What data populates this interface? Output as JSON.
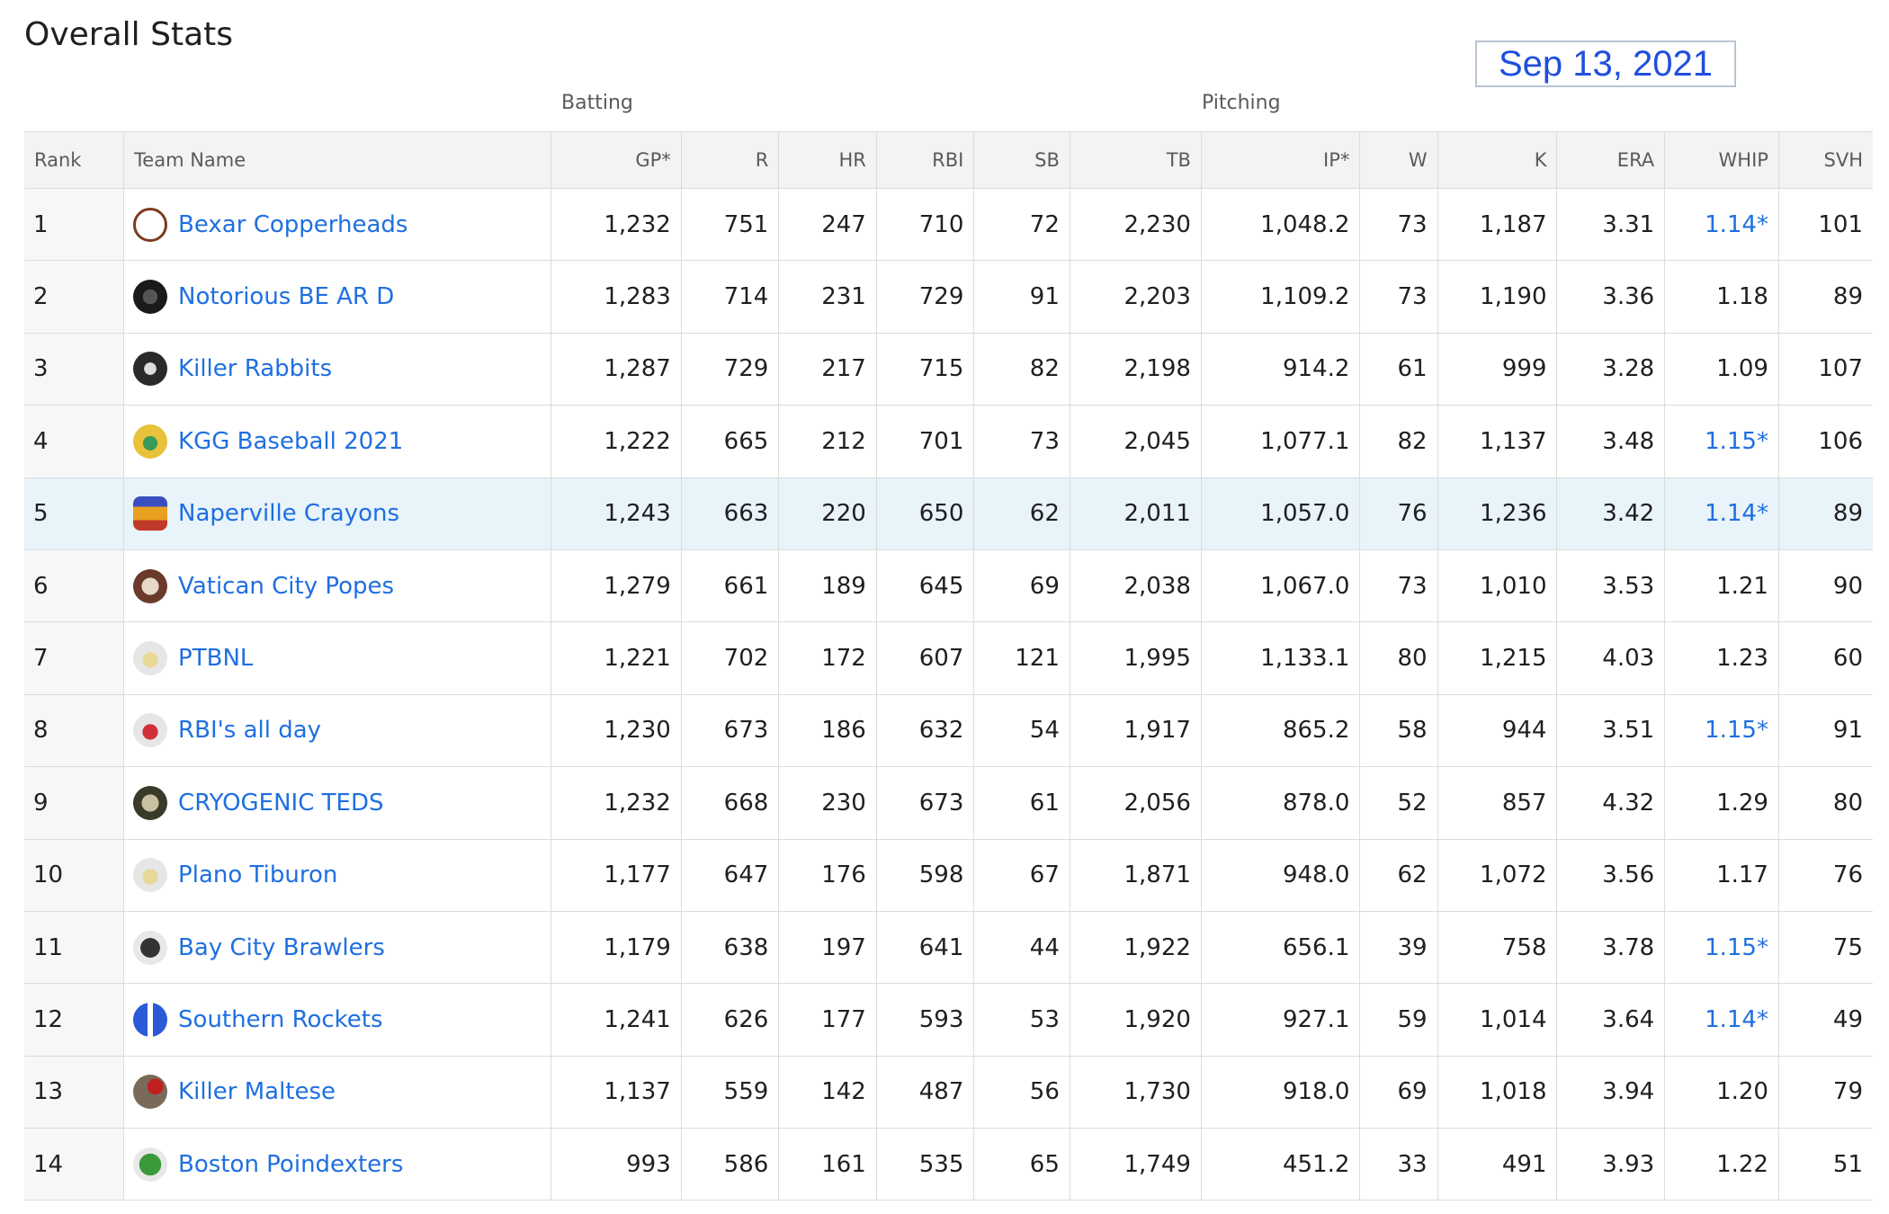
{
  "page": {
    "title": "Overall Stats",
    "date": "Sep 13, 2021",
    "group_batting": "Batting",
    "group_pitching": "Pitching"
  },
  "columns": [
    "Rank",
    "Team Name",
    "GP*",
    "R",
    "HR",
    "RBI",
    "SB",
    "TB",
    "IP*",
    "W",
    "K",
    "ERA",
    "WHIP",
    "SVH"
  ],
  "colors": {
    "link": "#1f6fe0",
    "date": "#1f4fe0",
    "highlight_row": "#e8f3fa",
    "header_bg": "#f3f3f3"
  },
  "rows": [
    {
      "rank": "1",
      "team": "Bexar Copperheads",
      "logo": "snake-icon",
      "gp": "1,232",
      "r": "751",
      "hr": "247",
      "rbi": "710",
      "sb": "72",
      "tb": "2,230",
      "ip": "1,048.2",
      "w": "73",
      "k": "1,187",
      "era": "3.31",
      "whip": "1.14*",
      "svh": "101"
    },
    {
      "rank": "2",
      "team": "Notorious BE AR D",
      "logo": "bear-icon",
      "gp": "1,283",
      "r": "714",
      "hr": "231",
      "rbi": "729",
      "sb": "91",
      "tb": "2,203",
      "ip": "1,109.2",
      "w": "73",
      "k": "1,190",
      "era": "3.36",
      "whip": "1.18",
      "svh": "89"
    },
    {
      "rank": "3",
      "team": "Killer Rabbits",
      "logo": "rabbit-icon",
      "gp": "1,287",
      "r": "729",
      "hr": "217",
      "rbi": "715",
      "sb": "82",
      "tb": "2,198",
      "ip": "914.2",
      "w": "61",
      "k": "999",
      "era": "3.28",
      "whip": "1.09",
      "svh": "107"
    },
    {
      "rank": "4",
      "team": "KGG Baseball 2021",
      "logo": "cap-icon",
      "gp": "1,222",
      "r": "665",
      "hr": "212",
      "rbi": "701",
      "sb": "73",
      "tb": "2,045",
      "ip": "1,077.1",
      "w": "82",
      "k": "1,137",
      "era": "3.48",
      "whip": "1.15*",
      "svh": "106"
    },
    {
      "rank": "5",
      "team": "Naperville Crayons",
      "logo": "crayon-icon",
      "gp": "1,243",
      "r": "663",
      "hr": "220",
      "rbi": "650",
      "sb": "62",
      "tb": "2,011",
      "ip": "1,057.0",
      "w": "76",
      "k": "1,236",
      "era": "3.42",
      "whip": "1.14*",
      "svh": "89"
    },
    {
      "rank": "6",
      "team": "Vatican City Popes",
      "logo": "pope-icon",
      "gp": "1,279",
      "r": "661",
      "hr": "189",
      "rbi": "645",
      "sb": "69",
      "tb": "2,038",
      "ip": "1,067.0",
      "w": "73",
      "k": "1,010",
      "era": "3.53",
      "whip": "1.21",
      "svh": "90"
    },
    {
      "rank": "7",
      "team": "PTBNL",
      "logo": "cap-icon",
      "gp": "1,221",
      "r": "702",
      "hr": "172",
      "rbi": "607",
      "sb": "121",
      "tb": "1,995",
      "ip": "1,133.1",
      "w": "80",
      "k": "1,215",
      "era": "4.03",
      "whip": "1.23",
      "svh": "60"
    },
    {
      "rank": "8",
      "team": "RBI's all day",
      "logo": "cap-icon",
      "gp": "1,230",
      "r": "673",
      "hr": "186",
      "rbi": "632",
      "sb": "54",
      "tb": "1,917",
      "ip": "865.2",
      "w": "58",
      "k": "944",
      "era": "3.51",
      "whip": "1.15*",
      "svh": "91"
    },
    {
      "rank": "9",
      "team": "CRYOGENIC TEDS",
      "logo": "jar-icon",
      "gp": "1,232",
      "r": "668",
      "hr": "230",
      "rbi": "673",
      "sb": "61",
      "tb": "2,056",
      "ip": "878.0",
      "w": "52",
      "k": "857",
      "era": "4.32",
      "whip": "1.29",
      "svh": "80"
    },
    {
      "rank": "10",
      "team": "Plano Tiburon",
      "logo": "cap-icon",
      "gp": "1,177",
      "r": "647",
      "hr": "176",
      "rbi": "598",
      "sb": "67",
      "tb": "1,871",
      "ip": "948.0",
      "w": "62",
      "k": "1,072",
      "era": "3.56",
      "whip": "1.17",
      "svh": "76"
    },
    {
      "rank": "11",
      "team": "Bay City Brawlers",
      "logo": "dog-icon",
      "gp": "1,179",
      "r": "638",
      "hr": "197",
      "rbi": "641",
      "sb": "44",
      "tb": "1,922",
      "ip": "656.1",
      "w": "39",
      "k": "758",
      "era": "3.78",
      "whip": "1.15*",
      "svh": "75"
    },
    {
      "rank": "12",
      "team": "Southern Rockets",
      "logo": "rocket-icon",
      "gp": "1,241",
      "r": "626",
      "hr": "177",
      "rbi": "593",
      "sb": "53",
      "tb": "1,920",
      "ip": "927.1",
      "w": "59",
      "k": "1,014",
      "era": "3.64",
      "whip": "1.14*",
      "svh": "49"
    },
    {
      "rank": "13",
      "team": "Killer Maltese",
      "logo": "maltese-icon",
      "gp": "1,137",
      "r": "559",
      "hr": "142",
      "rbi": "487",
      "sb": "56",
      "tb": "1,730",
      "ip": "918.0",
      "w": "69",
      "k": "1,018",
      "era": "3.94",
      "whip": "1.20",
      "svh": "79"
    },
    {
      "rank": "14",
      "team": "Boston Poindexters",
      "logo": "frog-icon",
      "gp": "993",
      "r": "586",
      "hr": "161",
      "rbi": "535",
      "sb": "65",
      "tb": "1,749",
      "ip": "451.2",
      "w": "33",
      "k": "491",
      "era": "3.93",
      "whip": "1.22",
      "svh": "51"
    }
  ]
}
